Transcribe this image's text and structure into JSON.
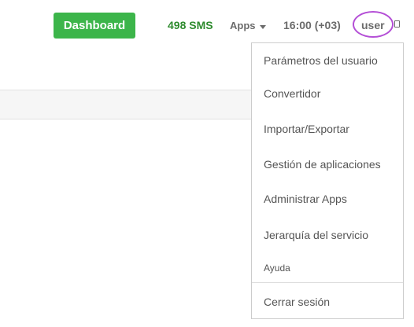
{
  "header": {
    "dashboard_label": "Dashboard",
    "sms_count": "498 SMS",
    "apps_label": "Apps",
    "time": "16:00 (+03)",
    "user_label": "user"
  },
  "user_menu": {
    "items": [
      {
        "label": "Parámetros del usuario"
      },
      {
        "label": "Convertidor"
      },
      {
        "label": "Importar/Exportar"
      },
      {
        "label": "Gestión de aplicaciones"
      },
      {
        "label": "Administrar Apps"
      },
      {
        "label": "Jerarquía del servicio"
      },
      {
        "label": "Ayuda"
      },
      {
        "label": "Cerrar sesión"
      }
    ]
  },
  "colors": {
    "accent_green": "#3cb54a",
    "sms_green": "#2e8b2e",
    "highlight_circle": "#b44fd6"
  }
}
